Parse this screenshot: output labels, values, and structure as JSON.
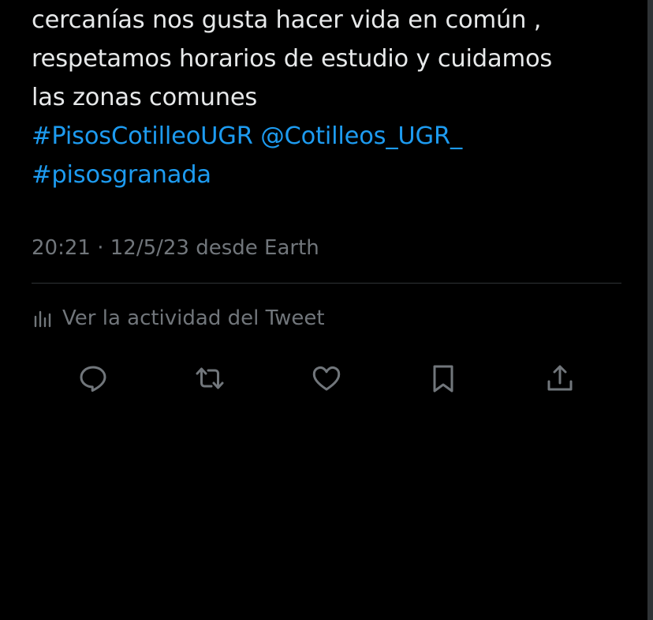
{
  "tweet": {
    "lines": [
      "cercanías nos gusta hacer vida en común ,",
      "respetamos horarios de estudio y cuidamos",
      "las zonas comunes"
    ],
    "hashtag_1": "#PisosCotilleoUGR",
    "mention": "@Cotilleos_UGR_",
    "hashtag_2": "#pisosgranada"
  },
  "meta": {
    "time": "20:21",
    "separator": "·",
    "date": "12/5/23",
    "source": "desde Earth"
  },
  "activity": {
    "label": "Ver la actividad del Tweet",
    "icon": "bar-chart-icon"
  },
  "actions": [
    {
      "name": "reply",
      "icon": "reply-icon"
    },
    {
      "name": "retweet",
      "icon": "retweet-icon"
    },
    {
      "name": "like",
      "icon": "heart-icon"
    },
    {
      "name": "bookmark",
      "icon": "bookmark-icon"
    },
    {
      "name": "share",
      "icon": "share-icon"
    }
  ],
  "colors": {
    "background": "#000000",
    "text": "#e7e9ea",
    "secondary_text": "#71767b",
    "link": "#1d9bf0",
    "divider": "#2f3336"
  }
}
